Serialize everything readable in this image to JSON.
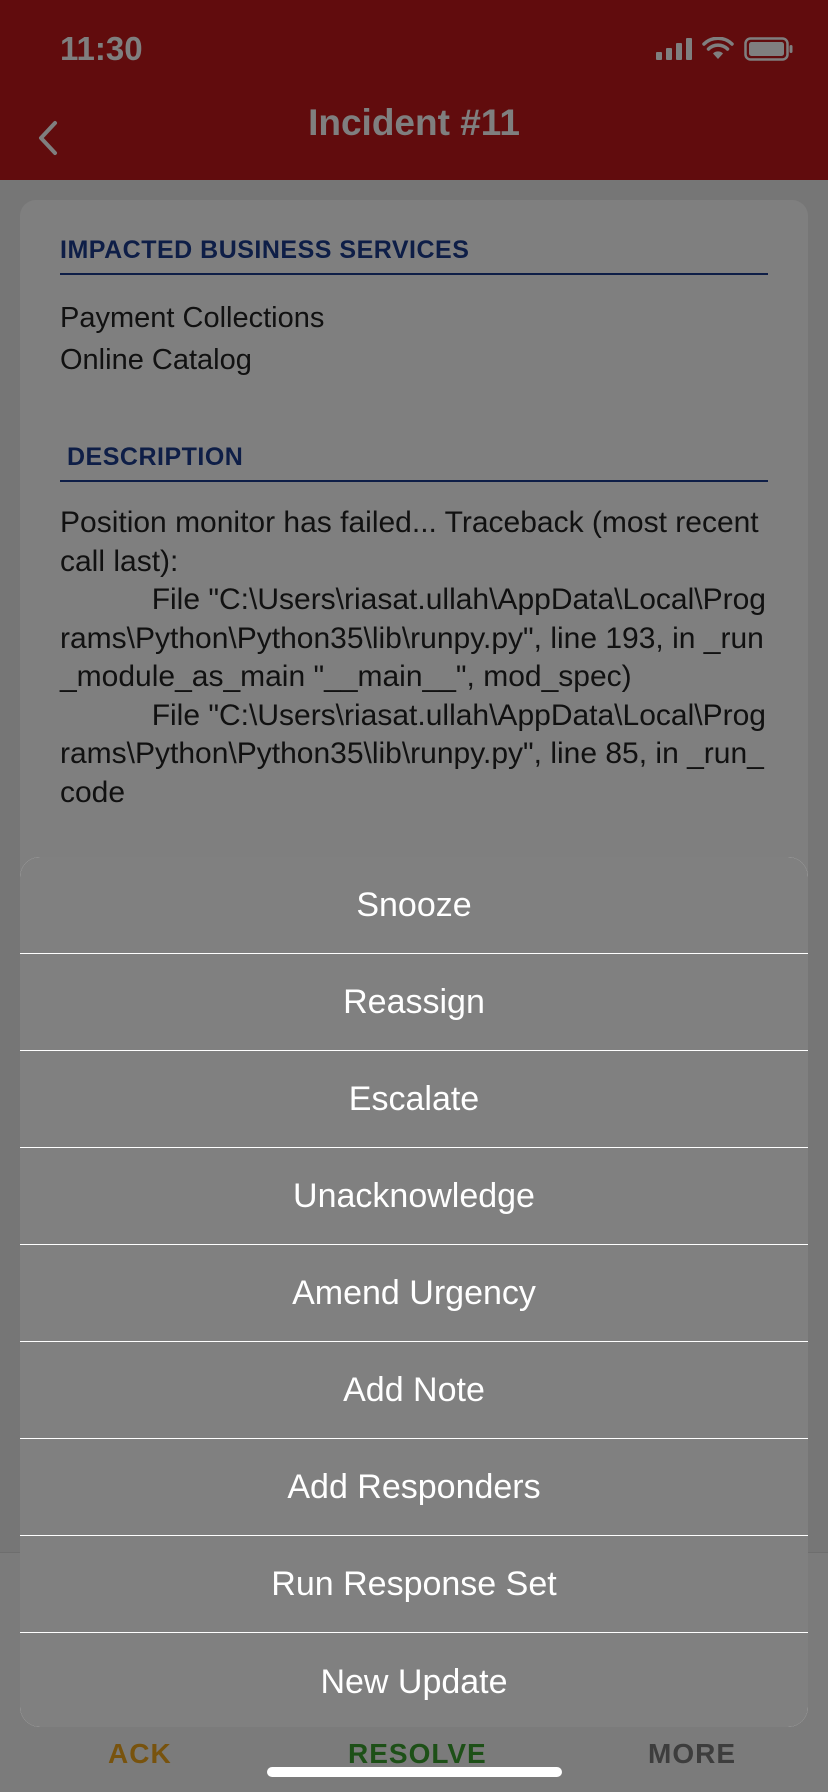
{
  "status_bar": {
    "time": "11:30",
    "icons": [
      "signal-icon",
      "wifi-icon",
      "battery-icon"
    ]
  },
  "nav": {
    "title": "Incident #11",
    "back_icon": "chevron-left-icon"
  },
  "card": {
    "impacted_title": "IMPACTED BUSINESS SERVICES",
    "services": [
      "Payment Collections",
      "Online Catalog"
    ],
    "description_title": "DESCRIPTION",
    "description_text": "Position monitor has failed... Traceback (most recent call last):\n           File \"C:\\Users\\riasat.ullah\\AppData\\Local\\Programs\\Python\\Python35\\lib\\runpy.py\", line 193, in _run_module_as_main \"__main__\", mod_spec)\n           File \"C:\\Users\\riasat.ullah\\AppData\\Local\\Programs\\Python\\Python35\\lib\\runpy.py\", line 85, in _run_code"
  },
  "tabbar": {
    "ack": "ACK",
    "resolve": "RESOLVE",
    "more": "MORE"
  },
  "action_sheet": {
    "items": [
      "Snooze",
      "Reassign",
      "Escalate",
      "Unacknowledge",
      "Amend Urgency",
      "Add Note",
      "Add Responders",
      "Run Response Set",
      "New Update"
    ]
  },
  "colors": {
    "header_red": "#c2191a",
    "section_blue": "#1d3d8f",
    "ack_orange": "#f0a71c",
    "resolve_green": "#3aa02e",
    "action_gray": "#808080"
  }
}
